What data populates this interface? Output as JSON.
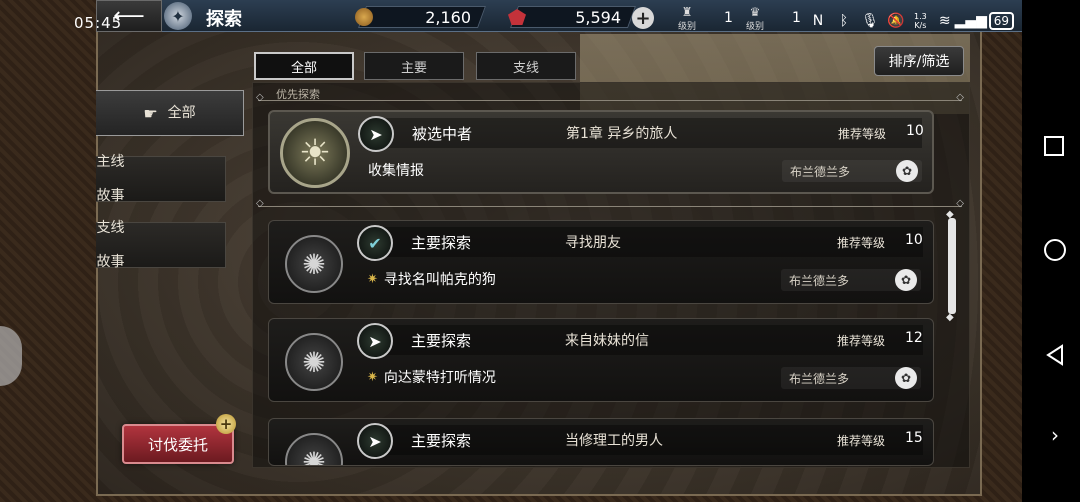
{
  "status_bar": {
    "time": "05:45",
    "net_speed_value": "1.3",
    "net_speed_unit": "K/s",
    "battery": "69"
  },
  "header": {
    "title": "探索",
    "gold": "2,160",
    "gems": "5,594",
    "level1_label": "级别",
    "level1_value": "1",
    "level2_label": "级别",
    "level2_value": "1"
  },
  "tabs": [
    {
      "label": "全部",
      "active": true
    },
    {
      "label": "主要",
      "active": false
    },
    {
      "label": "支线",
      "active": false
    }
  ],
  "sort_label": "排序/筛选",
  "sidebar": {
    "all": "全部",
    "main_line1": "主线",
    "main_line2": "故事",
    "side_line1": "支线",
    "side_line2": "故事"
  },
  "commission": "讨伐委托",
  "section_label": "优先探索",
  "quests": [
    {
      "type": "被选中者",
      "chapter": "第1章  异乡的旅人",
      "rec_label": "推荐等级",
      "level": "10",
      "sub": "收集情报",
      "region": "布兰德兰多",
      "featured": true
    },
    {
      "type": "主要探索",
      "chapter": "寻找朋友",
      "rec_label": "推荐等级",
      "level": "10",
      "sub": "寻找名叫帕克的狗",
      "region": "布兰德兰多",
      "featured": false
    },
    {
      "type": "主要探索",
      "chapter": "来自妹妹的信",
      "rec_label": "推荐等级",
      "level": "12",
      "sub": "向达蒙特打听情况",
      "region": "布兰德兰多",
      "featured": false
    },
    {
      "type": "主要探索",
      "chapter": "当修理工的男人",
      "rec_label": "推荐等级",
      "level": "15",
      "sub": "",
      "region": "",
      "featured": false
    }
  ],
  "colors": {
    "header_bg": "#1a2633",
    "commission_red": "#b1343e",
    "accent_gold": "#d9b64a"
  }
}
